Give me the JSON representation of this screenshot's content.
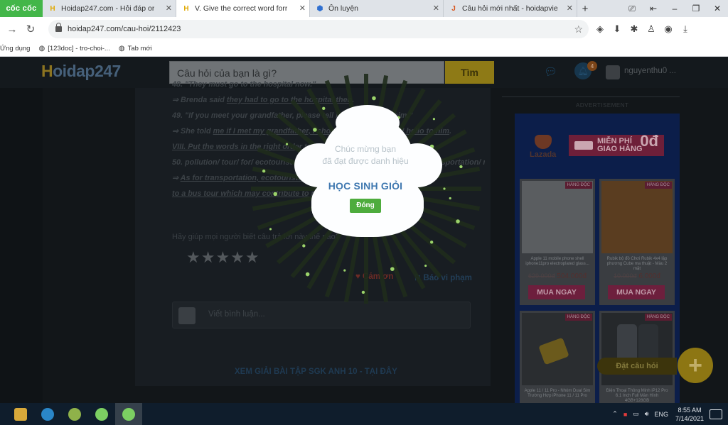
{
  "browser": {
    "brand_tab": "cốc cốc",
    "tabs": [
      {
        "favicon": "hoidap-favicon",
        "title": "Hoidap247.com - Hỏi đáp or"
      },
      {
        "favicon": "hoidap-favicon",
        "title": "V. Give the correct word forr"
      },
      {
        "favicon": "olm-favicon",
        "title": "Ôn luyện"
      },
      {
        "favicon": "j-favicon",
        "title": "Câu hỏi mới nhất - hoidapvie"
      }
    ],
    "address": "hoidap247.com/cau-hoi/2112423",
    "bookmarks": [
      {
        "icon": "apps-icon",
        "label": "Ứng dụng"
      },
      {
        "icon": "globe-icon",
        "label": "[123doc] - tro-choi-..."
      },
      {
        "icon": "globe-icon",
        "label": "Tab mới"
      }
    ]
  },
  "site": {
    "logo": "Hoidap247",
    "search_placeholder": "Câu hỏi của bạn là gì?",
    "search_button": "Tìm",
    "notification_count": "4",
    "username": "nguyenthu0 ..."
  },
  "answer": {
    "lines": [
      {
        "prefix": "48. ",
        "text": "\"They must go to the hospital now.\""
      },
      {
        "prefix": "⇒ Brenda said ",
        "u": "they had to go to the hospital then",
        "suffix": "."
      },
      {
        "prefix": "49. ",
        "text": "\"If you meet your grandfather, please tell him I said hello him.\""
      },
      {
        "prefix": "⇒ She told ",
        "u": "me if I met my grandfather, I should tell him she said hello to him",
        "suffix": "."
      },
      {
        "prefix": "",
        "u": "VIII. Put the words in the right order to make complete sentences",
        "suffix": "."
      },
      {
        "prefix": "50. ",
        "text": "pollution/ tour/ for/ ecotourists/ as/ walking/ better/ it/ to/ a/ prefer/ transportation/ may/ bus/ tour/ walking."
      },
      {
        "prefix": "⇒ ",
        "u": "As for transportation, ecotourists may prefer a walking tour",
        "suffix": ""
      },
      {
        "prefix": "",
        "u": "to a bus tour which may contribute to pollution",
        "suffix": "."
      }
    ],
    "help_text": "Hãy giúp mọi người biết câu trả lời này thế nào?",
    "stars": "★★★★★",
    "thanks": "Cảm ơn",
    "report": "Báo vi phạm",
    "comment_placeholder": "Viết bình luận...",
    "sgk_link": "XEM GIẢI BÀI TẬP SGK ANH 10 - TẠI ĐÂY"
  },
  "ad": {
    "label": "ADVERTISEMENT",
    "lazada": "Lazada",
    "free_ship_1": "MIỄN PHÍ",
    "free_ship_2": "GIAO HÀNG",
    "free_ship_zero": "0đ",
    "products": [
      {
        "tag": "HÀNG ĐỘC",
        "name": "Apple 11 mobile phone shell iphone11pro electroplated glass...",
        "old_price": "629.000đ",
        "price": "504.000đ",
        "buy": "MUA NGAY",
        "color": "#505356"
      },
      {
        "tag": "HÀNG ĐỘC",
        "name": "Rubik bộ đồ Chơi Rubik 4x4 lập phương Cube ma thuật - Màu 2 mặt",
        "old_price": "10.000đ",
        "price": "6.000đ",
        "buy": "MUA NGAY",
        "color": "#5a3d20"
      },
      {
        "tag": "HÀNG ĐỘC",
        "name": "Apple 11 / 11 Pro - Nhóm Dual Sim Trường Hợp iPhone 11 / 11 Pro",
        "color": "#5b4a17"
      },
      {
        "tag": "HÀNG ĐỘC",
        "name": "Điện Thoại Thông Minh iP12 Pro 6.1 Inch Full Màn Hình 4GB+128GB",
        "color": "#25282b"
      }
    ],
    "ask_button": "Đặt câu hỏi",
    "fab": "+"
  },
  "modal": {
    "congrats_1": "Chúc mừng bạn",
    "congrats_2": "đã đạt được danh hiệu",
    "title": "HỌC SINH GIỎI",
    "close": "Đóng"
  },
  "taskbar": {
    "tray_lang": "ENG",
    "time": "8:55 AM",
    "date": "7/14/2021"
  }
}
